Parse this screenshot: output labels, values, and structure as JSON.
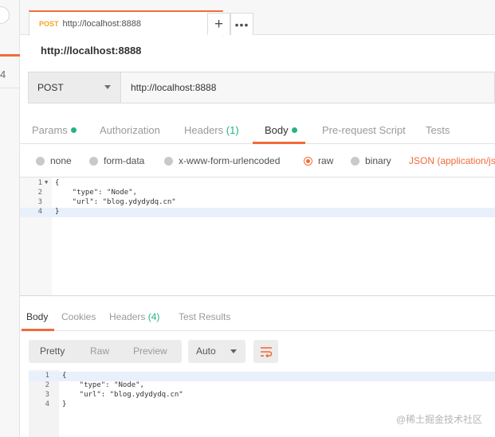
{
  "left_panel": {
    "digit": "4"
  },
  "tab": {
    "method": "POST",
    "url": "http://localhost:8888",
    "unsaved": true
  },
  "tab_actions": {
    "add_icon": "+",
    "more_icon": "•••"
  },
  "request_title": "http://localhost:8888",
  "url_bar": {
    "method": "POST",
    "url": "http://localhost:8888"
  },
  "request_tabs": {
    "params": "Params",
    "authorization": "Authorization",
    "headers": "Headers",
    "headers_count": "(1)",
    "body": "Body",
    "pre_request": "Pre-request Script",
    "tests": "Tests",
    "active": "Body"
  },
  "body_types": {
    "none": "none",
    "form_data": "form-data",
    "urlencoded": "x-www-form-urlencoded",
    "raw": "raw",
    "binary": "binary",
    "content_type": "JSON (application/js",
    "selected": "raw"
  },
  "request_body": {
    "line_numbers": [
      "1",
      "2",
      "3",
      "4"
    ],
    "lines": [
      "{",
      "    \"type\": \"Node\",",
      "    \"url\": \"blog.ydydydq.cn\"",
      "}"
    ]
  },
  "response_tabs": {
    "body": "Body",
    "cookies": "Cookies",
    "headers": "Headers",
    "headers_count": "(4)",
    "test_results": "Test Results",
    "active": "Body"
  },
  "response_toolbar": {
    "pretty": "Pretty",
    "raw": "Raw",
    "preview": "Preview",
    "format": "Auto"
  },
  "response_body": {
    "line_numbers": [
      "1",
      "2",
      "3",
      "4"
    ],
    "lines": [
      "{",
      "    \"type\": \"Node\",",
      "    \"url\": \"blog.ydydydq.cn\"",
      "}"
    ]
  },
  "watermark": "@稀土掘金技术社区",
  "colors": {
    "accent": "#f26b3a",
    "green": "#26b47f",
    "method_post": "#f5a623"
  }
}
